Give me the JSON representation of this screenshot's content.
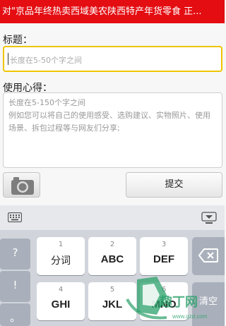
{
  "banner": {
    "text": "对\"京品年终热卖西域美农陕西特产年货零食 正..."
  },
  "form": {
    "title_label": "标题：",
    "title_placeholder": "长度在5-50个字之间",
    "experience_label": "使用心得：",
    "experience_hint_line1": "长度在5-150个字之间",
    "experience_hint_line2": "例如您可以将自己的使用感受、选购建议、实物照片、使用场景、拆包过程等与网友们分享;",
    "submit_label": "提交",
    "camera_icon": "camera-icon"
  },
  "keyboard": {
    "side_keys": [
      "?",
      "!",
      "。"
    ],
    "keys": [
      {
        "num": "1",
        "letters": "分词"
      },
      {
        "num": "2",
        "letters": "ABC"
      },
      {
        "num": "3",
        "letters": "DEF"
      },
      {
        "num": "4",
        "letters": "GHI"
      },
      {
        "num": "5",
        "letters": "JKL"
      },
      {
        "num": "6",
        "letters": "MNO"
      }
    ],
    "clear_label": "清空",
    "delete_icon": "backspace-icon",
    "keyboard_icon": "keyboard-icon",
    "hide_icon": "hide-keyboard-icon"
  },
  "watermark": {
    "text": "趣丁网",
    "url": "www.qzd.com"
  },
  "colors": {
    "banner": "#e40d12",
    "focus_border": "#efc400",
    "keyboard_bg": "#d1d5db"
  }
}
